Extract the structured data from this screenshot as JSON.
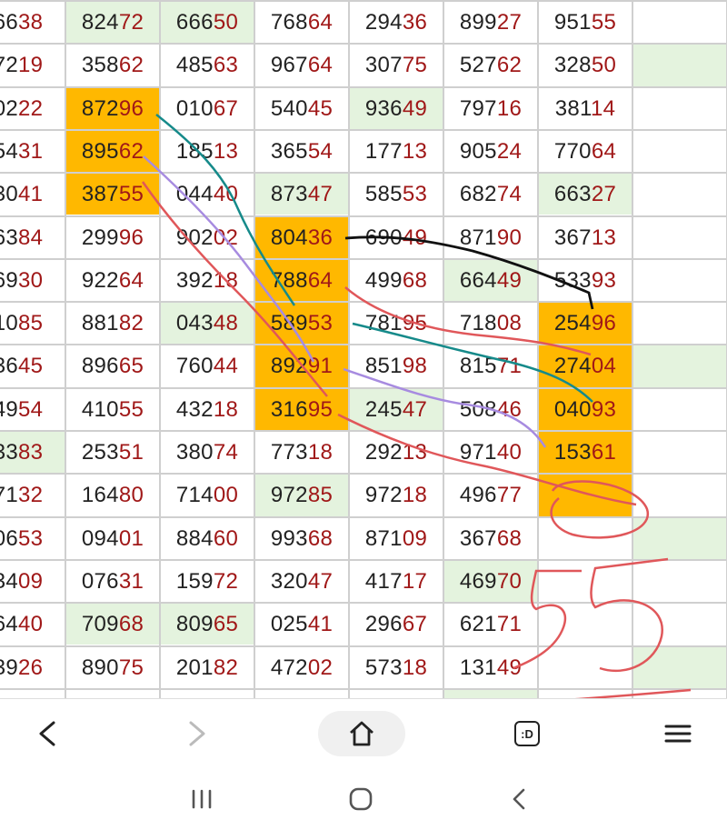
{
  "grid": {
    "rows": [
      [
        "66,38,",
        "824,72,g",
        "666,50,g",
        "768,64,",
        "294,36,",
        "899,27,",
        "951,55,",
        ",,"
      ],
      [
        "72,19,",
        "358,62,",
        "485,63,",
        "967,64,",
        "307,75,",
        "527,62,",
        "328,50,",
        ",,g"
      ],
      [
        "02,22,",
        "872,96,o",
        "010,67,",
        "540,45,",
        "936,49,g",
        "797,16,",
        "381,14,",
        ",,"
      ],
      [
        "54,31,",
        "895,62,o",
        "185,13,",
        "365,54,",
        "177,13,",
        "905,24,",
        "770,64,",
        ",,"
      ],
      [
        "30,41,",
        "387,55,o",
        "044,40,",
        "873,47,g",
        "585,53,",
        "682,74,",
        "663,27,g",
        ",,"
      ],
      [
        "63,84,",
        "299,96,",
        "902,02,",
        "804,36,o",
        "690,49,",
        "871,90,",
        "367,13,",
        ",,"
      ],
      [
        "69,30,",
        "922,64,",
        "392,18,",
        "788,64,o",
        "499,68,",
        "664,49,g",
        "533,93,",
        ",,"
      ],
      [
        "10,85,",
        "881,82,",
        "043,48,g",
        "589,53,o",
        "781,95,",
        "718,08,",
        "254,96,o",
        ",,"
      ],
      [
        "36,45,",
        "896,65,",
        "760,44,",
        "892,91,o",
        "851,98,",
        "815,71,",
        "274,04,o",
        ",,g"
      ],
      [
        "49,54,",
        "410,55,",
        "432,18,",
        "316,95,o",
        "245,47,g",
        "508,46,",
        "040,93,o",
        ",,"
      ],
      [
        "33,83,g",
        "253,51,",
        "380,74,",
        "773,18,",
        "292,13,",
        "971,40,",
        "153,61,o",
        ",,"
      ],
      [
        "71,32,",
        "164,80,",
        "714,00,",
        "972,85,g",
        "972,18,",
        "496,77,",
        ",,o",
        ",,"
      ],
      [
        "06,53,",
        "094,01,",
        "884,60,",
        "993,68,",
        "871,09,",
        "367,68,",
        ",,",
        ",,g"
      ],
      [
        "34,09,",
        "076,31,",
        "159,72,",
        "320,47,",
        "417,17,",
        "469,70,g",
        ",,",
        ",,"
      ],
      [
        "64,40,",
        "709,68,g",
        "809,65,g",
        "025,41,",
        "296,67,",
        "621,71,",
        ",,",
        ",,"
      ],
      [
        "39,26,",
        "890,75,",
        "201,82,",
        "472,02,",
        "573,18,",
        "131,49,",
        ",,",
        ",,g"
      ],
      [
        ",,",
        ",,",
        ",,",
        ",,",
        ",,",
        ",,g",
        ",,",
        ",,"
      ]
    ]
  },
  "annotations": {
    "handwritten_number": "55",
    "colors": {
      "teal": "#168a8a",
      "purple": "#a78be0",
      "red": "#e0575a",
      "black": "#111111",
      "orange": "#ffb800",
      "green_bg": "#e4f3de"
    }
  },
  "browser_nav": {
    "back_icon": "chevron-left-icon",
    "forward_icon": "chevron-right-icon",
    "home_icon": "home-icon",
    "tab_icon_label": ":D",
    "menu_icon": "hamburger-icon"
  },
  "system_nav": {
    "recents_icon": "recents-icon",
    "home_icon": "circle-home-icon",
    "back_icon": "back-chevron-icon"
  }
}
